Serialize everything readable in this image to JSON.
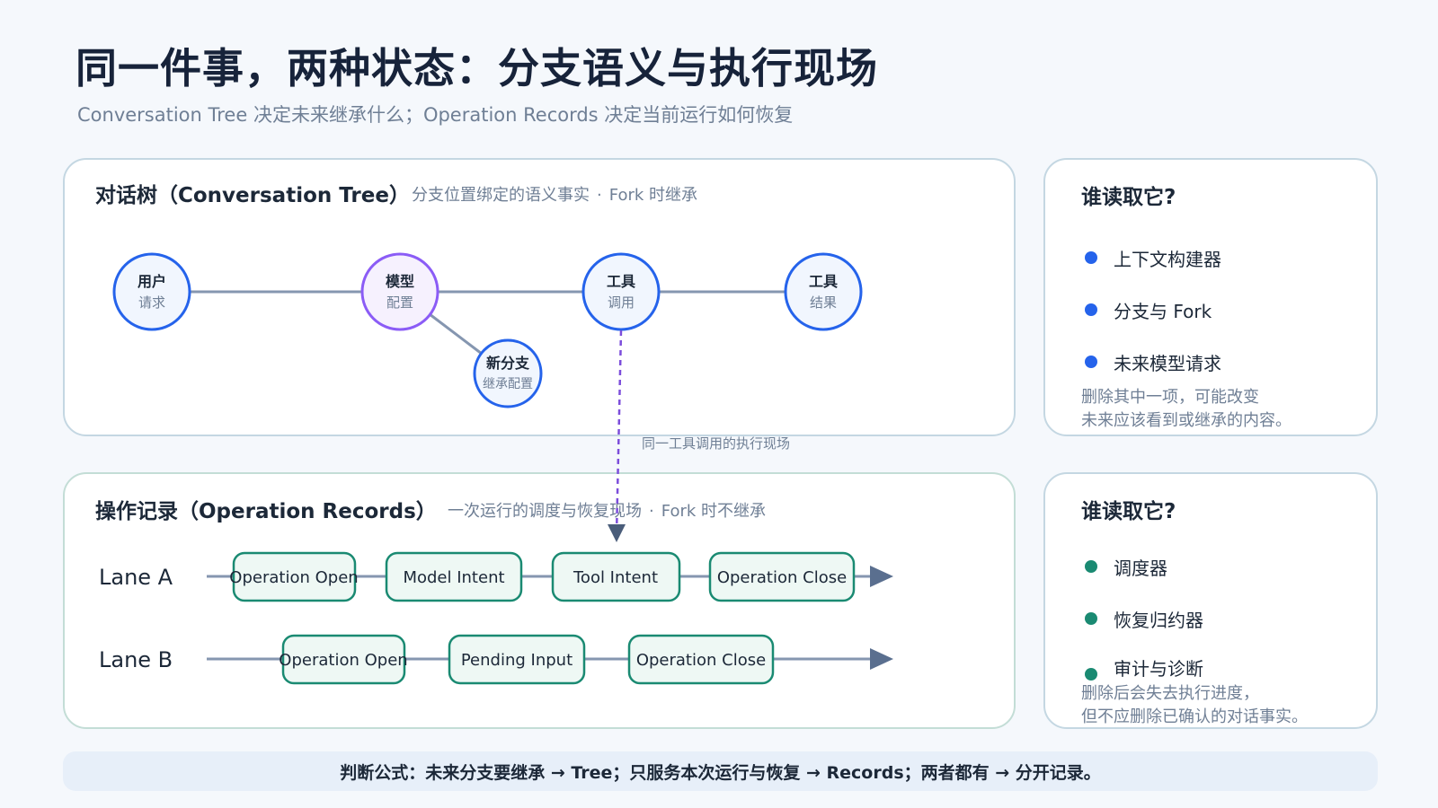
{
  "header": {
    "title": "同一件事，两种状态：分支语义与执行现场",
    "subtitle": "Conversation Tree 决定未来继承什么；Operation Records 决定当前运行如何恢复"
  },
  "tree_panel": {
    "heading": "对话树（Conversation Tree）",
    "desc_part1": "分支位置绑定的语义事实",
    "desc_sep": "·",
    "desc_part2": "Fork 时继承",
    "nodes": [
      {
        "line1": "用户",
        "line2": "请求"
      },
      {
        "line1": "模型",
        "line2": "配置"
      },
      {
        "line1": "工具",
        "line2": "调用"
      },
      {
        "line1": "工具",
        "line2": "结果"
      },
      {
        "line1": "新分支",
        "line2": "继承配置"
      }
    ]
  },
  "cross_link": {
    "label": "同一工具调用的执行现场"
  },
  "records_panel": {
    "heading": "操作记录（Operation Records）",
    "desc_part1": "一次运行的调度与恢复现场",
    "desc_sep": "·",
    "desc_part2": "Fork 时不继承",
    "lanes": [
      {
        "name": "Lane A",
        "items": [
          "Operation Open",
          "Model Intent",
          "Tool Intent",
          "Operation Close"
        ]
      },
      {
        "name": "Lane B",
        "items": [
          "Operation Open",
          "Pending Input",
          "Operation Close"
        ]
      }
    ]
  },
  "reader_panel_1": {
    "title": "谁读取它?",
    "items": [
      "上下文构建器",
      "分支与 Fork",
      "未来模型请求"
    ],
    "note_line1": "删除其中一项，可能改变",
    "note_line2": "未来应该看到或继承的内容。",
    "dot_color": "#2563eb"
  },
  "reader_panel_2": {
    "title": "谁读取它?",
    "items": [
      "调度器",
      "恢复归约器",
      "审计与诊断"
    ],
    "note_line1": "删除后会失去执行进度，",
    "note_line2": "但不应删除已确认的对话事实。",
    "dot_color": "#1a8a72"
  },
  "footer": {
    "formula": "判断公式：未来分支要继承 → Tree；只服务本次运行与恢复 → Records；两者都有 → 分开记录。"
  },
  "colors": {
    "tree_node_stroke": "#2563eb",
    "model_node_stroke": "#8b5cf6",
    "pill_stroke": "#1a8a72",
    "pill_fill": "#eef8f4",
    "edge": "#8596b0",
    "dashed_link": "#7c4ddb"
  }
}
